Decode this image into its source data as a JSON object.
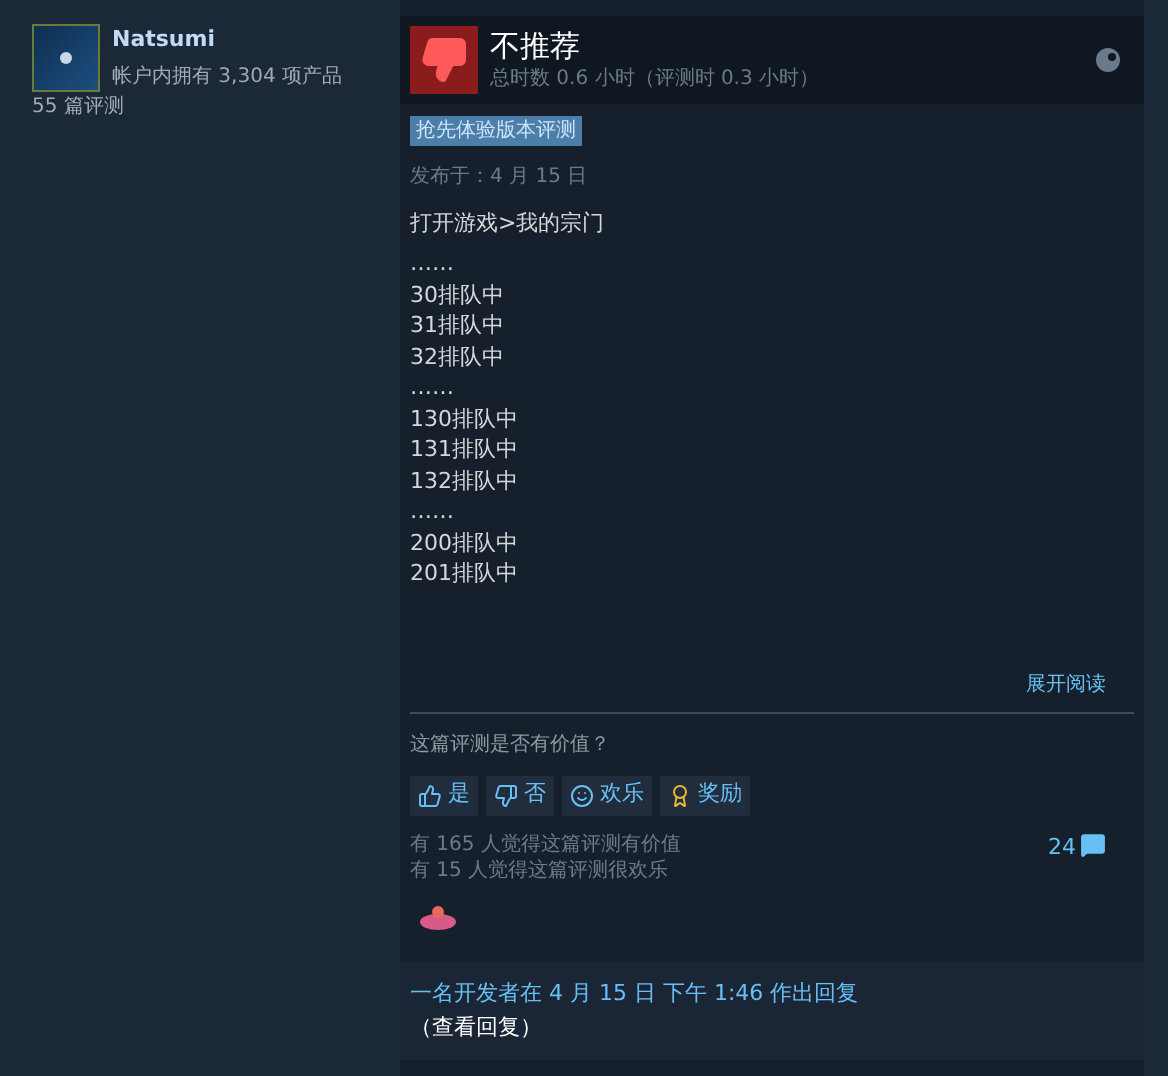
{
  "author": {
    "name": "Natsumi",
    "products": "帐户内拥有 3,304 项产品",
    "reviews": "55 篇评测"
  },
  "review": {
    "verdict": "不推荐",
    "recommended": false,
    "hours": "总时数 0.6 小时（评测时 0.3 小时）",
    "badge": "抢先体验版本评测",
    "posted": "发布于：4 月 15 日",
    "lines": [
      "打开游戏>我的宗门",
      "……",
      "30排队中",
      "31排队中",
      "32排队中",
      "……",
      "130排队中",
      "131排队中",
      "132排队中",
      "……",
      "200排队中",
      "201排队中"
    ],
    "expand": "展开阅读"
  },
  "feedback": {
    "question": "这篇评测是否有价值？",
    "buttons": [
      {
        "kind": "yes",
        "label": "是"
      },
      {
        "kind": "no",
        "label": "否"
      },
      {
        "kind": "funny",
        "label": "欢乐"
      },
      {
        "kind": "award",
        "label": "奖励"
      }
    ],
    "stats": [
      "有 165 人觉得这篇评测有价值",
      "有 15 人觉得这篇评测很欢乐"
    ],
    "comments": "24"
  },
  "reply": {
    "text": "一名开发者在 4 月 15 日 下午 1:46 作出回复",
    "link": "（查看回复）"
  }
}
